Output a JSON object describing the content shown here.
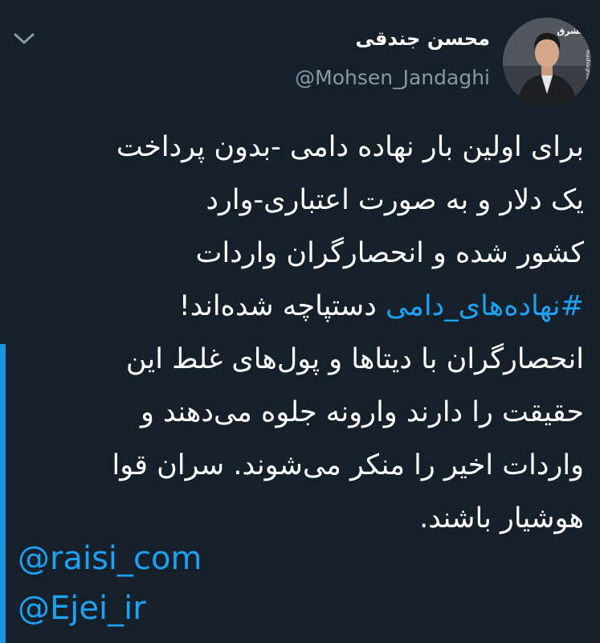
{
  "author": {
    "display_name": "محسن جندقی",
    "handle": "@Mohsen_Jandaghi",
    "avatar_watermark": "mashreghnews.ir"
  },
  "tweet": {
    "lines": [
      "برای اولین بار نهاده دامی -بدون پرداخت",
      "یک دلار و به صورت اعتباری-وارد",
      "کشور شده و انحصارگران واردات"
    ],
    "hashtag": "#نهاده‌های_دامی",
    "hashtag_line_rest": " دستپاچه شده‌اند!",
    "lines_after": [
      "انحصارگران با دیتاها و پول‌های غلط این",
      "حقیقت را دارند وارونه جلوه می‌دهند و",
      "واردات اخیر را منکر می‌شوند. سران قوا",
      "هوشیار باشند."
    ],
    "mentions": [
      "@raisi_com",
      "@Ejei_ir"
    ]
  },
  "colors": {
    "background": "#15202b",
    "text": "#ffffff",
    "secondary_text": "#8899a6",
    "link": "#1da1f2",
    "thread_line": "#1b95e0"
  },
  "icons": {
    "menu": "chevron-down-icon"
  }
}
